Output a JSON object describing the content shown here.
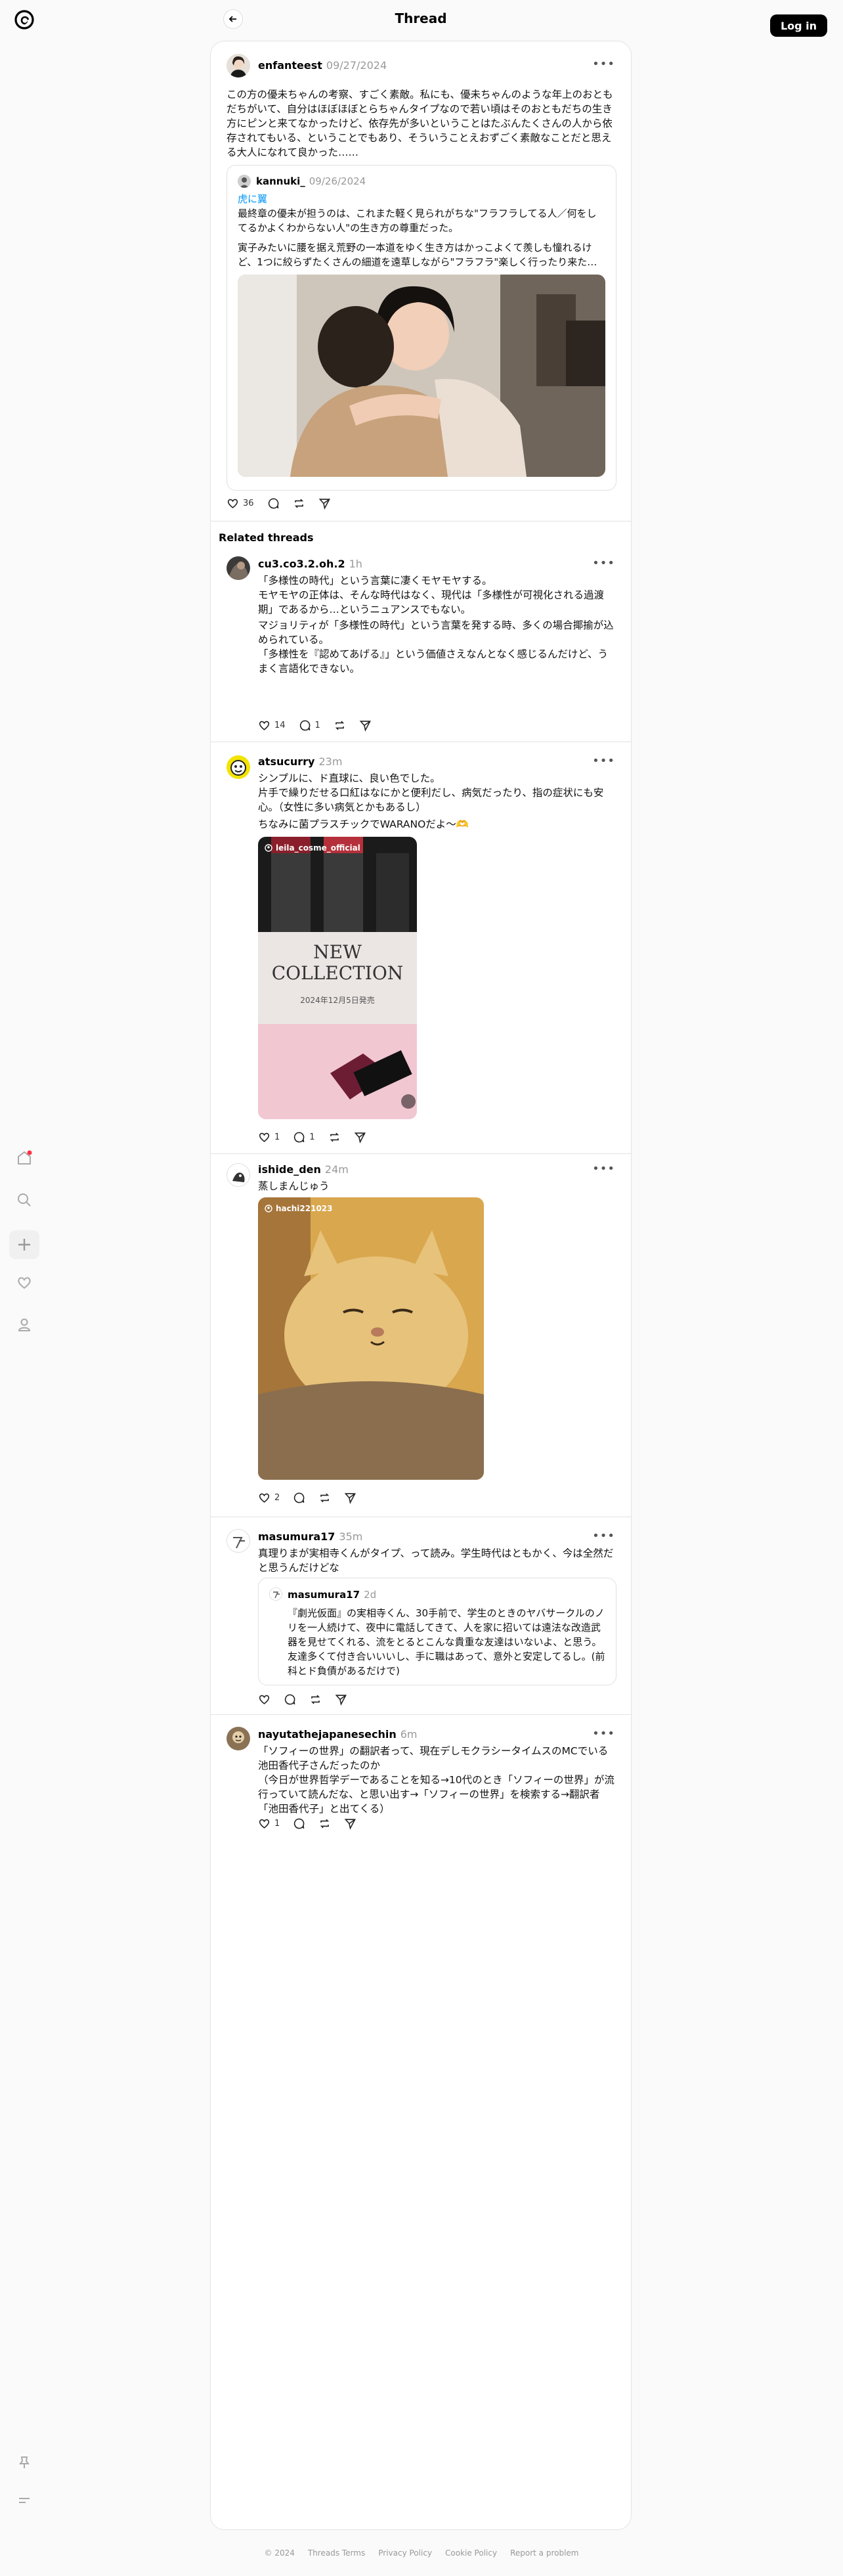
{
  "header": {
    "title": "Thread",
    "login_label": "Log in"
  },
  "main_post": {
    "username": "enfanteest",
    "date": "09/27/2024",
    "text": "この方の優未ちゃんの考察、すごく素敵。私にも、優未ちゃんのような年上のおともだちがいて、自分はほぼほぼとらちゃんタイプなので若い頃はそのおともだちの生き方にピンと来てなかったけど、依存先が多いということはたぶんたくさんの人から依存されてもいる、ということでもあり、そういうことえおずごく素敵なことだと思える大人になれて良かった……",
    "quote": {
      "username": "kannuki_",
      "date": "09/26/2024",
      "tag": "虎に翼",
      "text1": "最終章の優未が担うのは、これまた軽く見られがちな\"フラフラしてる人／何をしてるかよくわからない人\"の生き方の尊重だった。",
      "text2": "寅子みたいに腰を据え荒野の一本道をゆく生き方はかっこよくて羨しも憧れるけど、1つに絞らずたくさんの細道を遠草しながら\"フラフラ\"楽しく行ったり来た…"
    },
    "likes": "36"
  },
  "related_title": "Related threads",
  "posts": [
    {
      "username": "cu3.co3.2.oh.2",
      "time": "1h",
      "text1": "「多様性の時代」という言葉に凄くモヤモヤする。\nモヤモヤの正体は、そんな時代はなく、現代は「多様性が可視化される過渡期」であるから…というニュアンスでもない。",
      "text2": "マジョリティが「多様性の時代」という言葉を発する時、多くの場合揶揄が込められている。\n「多様性を『認めてあげる』」という価値さえなんとなく感じるんだけど、うまく言語化できない。",
      "likes": "14",
      "replies": "1"
    },
    {
      "username": "atsucurry",
      "time": "23m",
      "text1": "シンプルに、ド直球に、良い色でした。\n片手で繰りだせる口紅はなにかと便利だし、病気だったり、指の症状にも安心。（女性に多い病気とかもあるし）",
      "text2": "ちなみに菌プラスチックでWARANOだよ〜🫶",
      "image_tag": "leila_cosme_official",
      "image_headline": "NEW\nCOLLECTION",
      "image_sub": "2024年12月5日発売",
      "likes": "1",
      "replies": "1"
    },
    {
      "username": "ishide_den",
      "time": "24m",
      "text1": "蒸しまんじゅう",
      "image_tag": "hachi221023",
      "likes": "2"
    },
    {
      "username": "masumura17",
      "time": "35m",
      "text1": "真理りまが実相寺くんがタイプ、って読み。学生時代はともかく、今は全然だと思うんだけどな",
      "quote": {
        "username": "masumura17",
        "time": "2d",
        "text": "『劇光仮面』の実相寺くん、30手前で、学生のときのヤバサークルのノリを一人続けて、夜中に電話してきて、人を家に招いては遠法な改造武器を見せてくれる、流をとるとこんな貴重な友達はいないよ、と思う。友達多くて付き合いいいし、手に職はあって、意外と安定してるし。(前科とド負債があるだけで)"
      }
    },
    {
      "username": "nayutathejapanesechin",
      "time": "6m",
      "text1": "「ソフィーの世界」の翻訳者って、現在デしモクラシータイムスのMCでいる池田香代子さんだったのか\n（今日が世界哲学デーであることを知る→10代のとき「ソフィーの世界」が流行っていて読んだな、と思い出す→「ソフィーの世界」を検索する→翻訳者「池田香代子」と出てくる）",
      "likes": "1"
    }
  ],
  "footer": [
    "© 2024",
    "Threads Terms",
    "Privacy Policy",
    "Cookie Policy",
    "Report a problem"
  ]
}
